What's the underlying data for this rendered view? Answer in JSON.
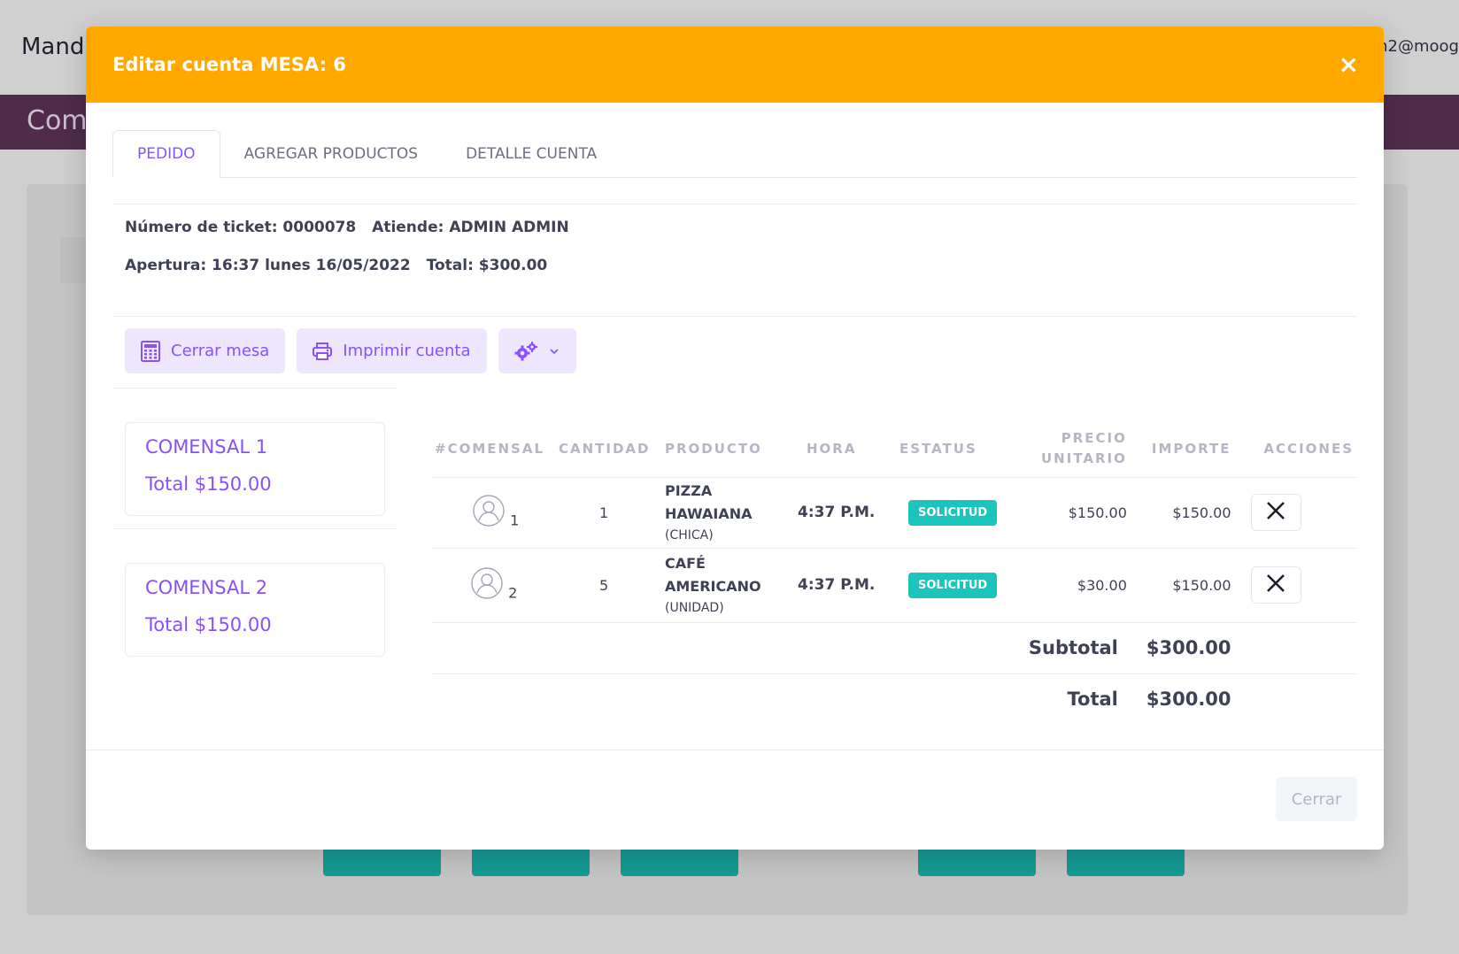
{
  "background": {
    "brand": "Mand",
    "user": "n2@moog",
    "page_title": "Com"
  },
  "modal": {
    "title": "Editar cuenta MESA: 6",
    "close_icon": "×",
    "tabs": [
      {
        "label": "PEDIDO",
        "active": true
      },
      {
        "label": "AGREGAR PRODUCTOS",
        "active": false
      },
      {
        "label": "DETALLE CUENTA",
        "active": false
      }
    ],
    "info": {
      "ticket": "Número de ticket: 0000078",
      "atiende": "Atiende: ADMIN ADMIN",
      "apertura": "Apertura: 16:37 lunes 16/05/2022",
      "total": "Total: $300.00"
    },
    "actions": {
      "cerrar_mesa": "Cerrar mesa",
      "imprimir_cuenta": "Imprimir cuenta",
      "settings_icon": "gears-icon"
    },
    "comensales": [
      {
        "name": "COMENSAL 1",
        "total": "Total $150.00"
      },
      {
        "name": "COMENSAL 2",
        "total": "Total $150.00"
      }
    ],
    "table": {
      "headers": {
        "comensal": "#COMENSAL",
        "cantidad": "CANTIDAD",
        "producto": "PRODUCTO",
        "hora": "HORA",
        "estatus": "ESTATUS",
        "precio_1": "PRECIO",
        "precio_2": "UNITARIO",
        "importe": "IMPORTE",
        "acciones": "ACCIONES"
      },
      "rows": [
        {
          "comensal": "1",
          "cantidad": "1",
          "producto": "PIZZA HAWAIANA",
          "tamano": "(CHICA)",
          "hora": "4:37 P.M.",
          "estatus": "SOLICITUD",
          "precio": "$150.00",
          "importe": "$150.00"
        },
        {
          "comensal": "2",
          "cantidad": "5",
          "producto": "CAFÉ AMERICANO",
          "tamano": "(UNIDAD)",
          "hora": "4:37 P.M.",
          "estatus": "SOLICITUD",
          "precio": "$30.00",
          "importe": "$150.00"
        }
      ],
      "subtotal_label": "Subtotal",
      "subtotal_value": "$300.00",
      "total_label": "Total",
      "total_value": "$300.00"
    },
    "footer": {
      "close_label": "Cerrar"
    }
  },
  "colors": {
    "header": "#ffa800",
    "accent": "#8950fc",
    "badge": "#1bc5bd",
    "bg_button": "#159a92",
    "purple_bar": "#4f2b4c"
  }
}
